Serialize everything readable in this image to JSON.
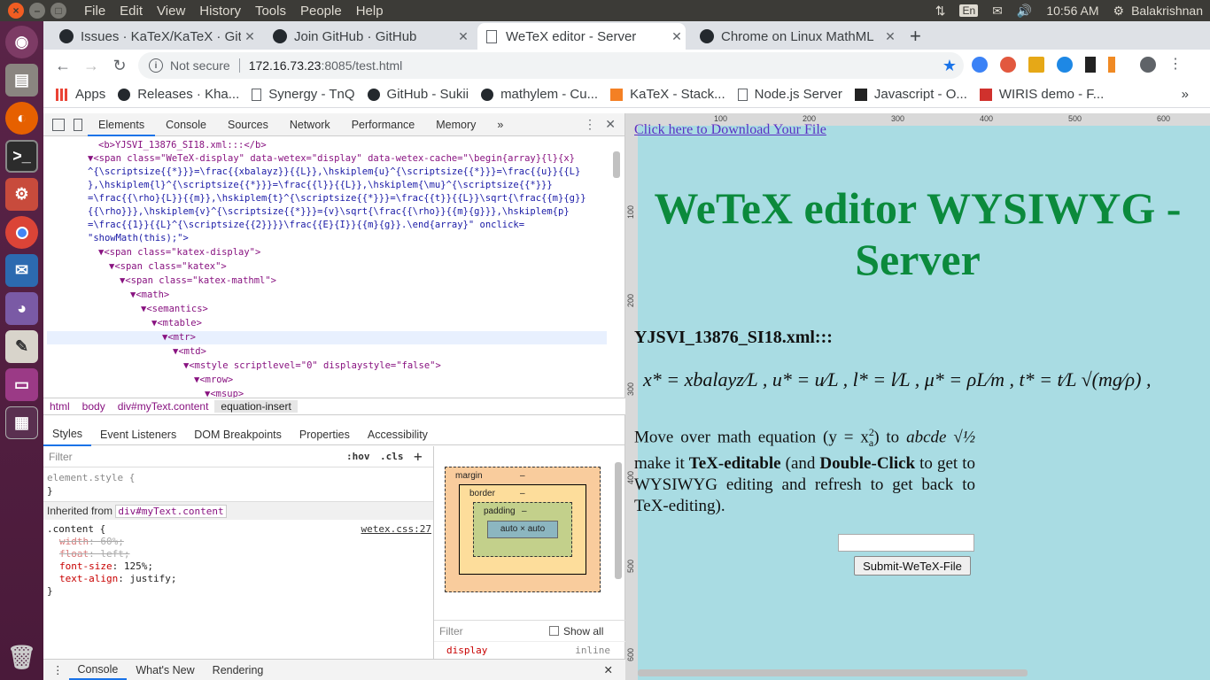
{
  "panel": {
    "menus": [
      "File",
      "Edit",
      "View",
      "History",
      "Tools",
      "People",
      "Help"
    ],
    "lang": "En",
    "time": "10:56 AM",
    "user": "Balakrishnan"
  },
  "tabs": [
    {
      "title": "Issues · KaTeX/KaTeX · Gith",
      "icon": "github-icon"
    },
    {
      "title": "Join GitHub · GitHub",
      "icon": "github-icon"
    },
    {
      "title": "WeTeX editor - Server",
      "icon": "document-icon"
    },
    {
      "title": "Chrome on Linux MathML",
      "icon": "github-icon"
    }
  ],
  "address": {
    "not_secure": "Not secure",
    "host": "172.16.73.23",
    "path": ":8085/test.html"
  },
  "bookmarks": [
    "Apps",
    "Releases · Kha...",
    "Synergy - TnQ",
    "GitHub - Sukii",
    "mathylem - Cu...",
    "KaTeX - Stack...",
    "Node.js Server",
    "Javascript - O...",
    "WIRIS demo - F...",
    "»"
  ],
  "devtools": {
    "tabs": [
      "Elements",
      "Console",
      "Sources",
      "Network",
      "Performance",
      "Memory",
      "»"
    ],
    "code": [
      "<b>YJSVI_13876_SI18.xml:::</b>",
      "▼<span class=\"WeTeX-display\" data-wetex=\"display\" data-wetex-cache=\"\\begin{array}{l}{x}",
      "^{\\scriptsize{{*}}}=\\frac{{xbalayz}}{{L}},\\hskiplem{u}^{\\scriptsize{{*}}}=\\frac{{u}}{{L}",
      "},\\hskiplem{l}^{\\scriptsize{{*}}}=\\frac{{l}}{{L}},\\hskiplem{\\mu}^{\\scriptsize{{*}}}",
      "=\\frac{{\\rho}{L}}{{m}},\\hskiplem{t}^{\\scriptsize{{*}}}=\\frac{{t}}{{L}}\\sqrt{\\frac{{m}{g}}",
      "{{\\rho}}},\\hskiplem{v}^{\\scriptsize{{*}}}={v}\\sqrt{\\frac{{\\rho}}{{m}{g}}},\\hskiplem{p}",
      "=\\frac{{1}}{{L}^{\\scriptsize{{2}}}}\\frac{{E}{I}}{{m}{g}}.\\end{array}\" onclick=",
      "\"showMath(this);\">",
      "▼<span class=\"katex-display\">",
      "▼<span class=\"katex\">",
      "▼<span class=\"katex-mathml\">",
      "▼<math>",
      "▼<semantics>",
      "▼<mtable>",
      "▼<mtr>",
      "▼<mtd>",
      "▼<mstyle scriptlevel=\"0\" displaystyle=\"false\">",
      "▼<mrow>",
      "▼<msup>"
    ],
    "crumbs": [
      "html",
      "body",
      "div#myText.content",
      "equation-insert"
    ],
    "style_tabs": [
      "Styles",
      "Event Listeners",
      "DOM Breakpoints",
      "Properties",
      "Accessibility"
    ],
    "filter_placeholder": "Filter",
    "hov": ":hov",
    "cls": ".cls",
    "element_style": "element.style {",
    "inherited_from": "Inherited from",
    "inherited_selector": "div#myText.content",
    "rule_selector": ".content {",
    "rule_source": "wetex.css:27",
    "rules": [
      {
        "prop": "width",
        "val": "60%;",
        "struck": true
      },
      {
        "prop": "float",
        "val": "left;",
        "struck": true
      },
      {
        "prop": "font-size",
        "val": "125%;",
        "struck": false
      },
      {
        "prop": "text-align",
        "val": "justify;",
        "struck": false
      }
    ],
    "box": {
      "margin": "margin",
      "border": "border",
      "padding": "padding",
      "content": "auto × auto",
      "dash": "–"
    },
    "computed_filter": "Filter",
    "show_all": "Show all",
    "computed_prop": "display",
    "computed_val": "inline",
    "console_tabs": [
      "Console",
      "What's New",
      "Rendering"
    ]
  },
  "page": {
    "link": "Click here to Download Your File",
    "title": "WeTeX editor WYSIWYG - Server",
    "eq_label": "YJSVI_13876_SI18.xml:::",
    "equation": "x* = xbalayz⁄L ,   u* = u⁄L ,   l* = l⁄L ,   μ* = ρL⁄m ,   t* = t⁄L √(mg⁄ρ) ,",
    "para_text_1": "Move over math equation (y = x",
    "para_sup": "2",
    "para_sub": "a",
    "para_text_2": ") to ",
    "para_math": "abcde √½",
    "para_text_3": " make it ",
    "para_bold_1": "TeX-editable",
    "para_text_4": " (and ",
    "para_bold_2": "Double-Click",
    "para_text_5": " to get to WYSIWYG editing and refresh to get back to TeX-editing).",
    "submit": "Submit-WeTeX-File",
    "ruler_top": [
      "100",
      "200",
      "300",
      "400",
      "500",
      "600"
    ],
    "ruler_left": [
      "100",
      "200",
      "300",
      "400",
      "500",
      "600"
    ]
  }
}
